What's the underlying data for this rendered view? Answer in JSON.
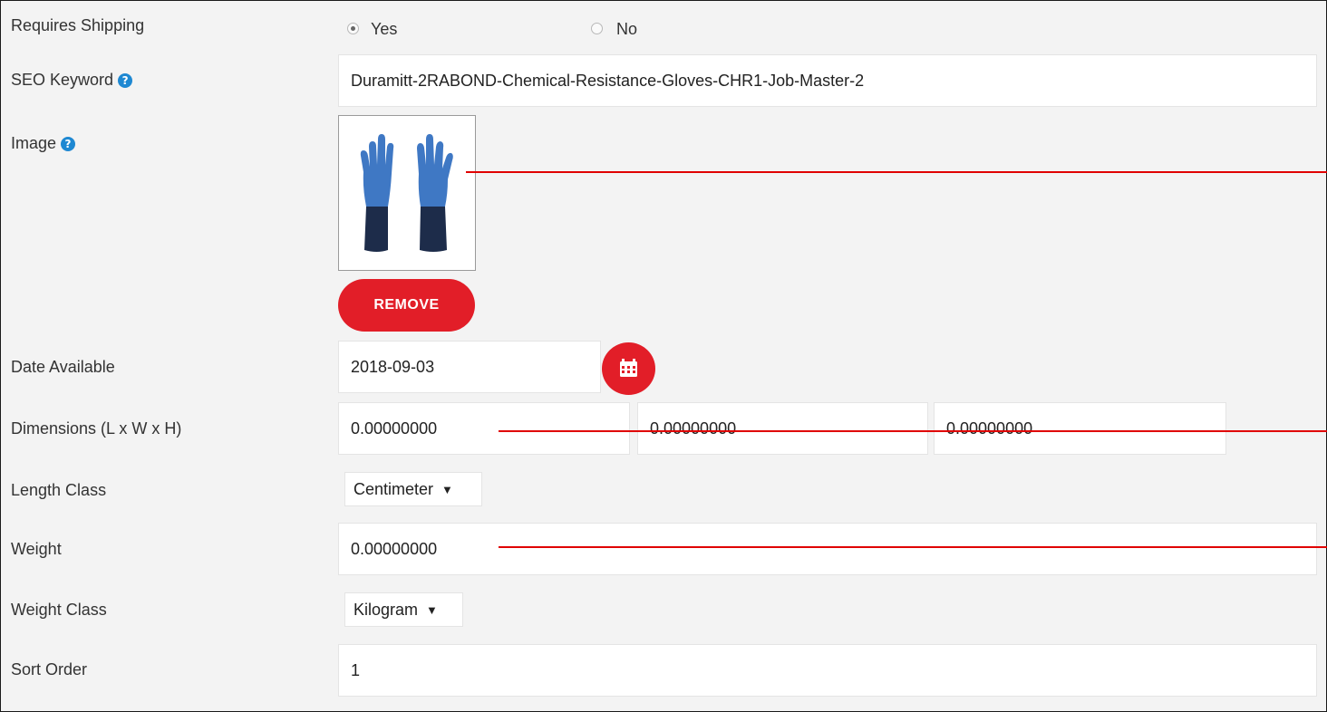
{
  "colors": {
    "accent": "#e21e28",
    "help": "#1e88d2",
    "annotation_line": "#e00000"
  },
  "shipping": {
    "label": "Requires Shipping",
    "yes_label": "Yes",
    "no_label": "No",
    "selected": "Yes"
  },
  "seo": {
    "label": "SEO Keyword",
    "value": "Duramitt-2RABOND-Chemical-Resistance-Gloves-CHR1-Job-Master-2",
    "help_icon": "question-circle-icon"
  },
  "image": {
    "label": "Image",
    "help_icon": "question-circle-icon",
    "remove_label": "REMOVE"
  },
  "date": {
    "label": "Date Available",
    "value": "2018-09-03",
    "icon": "calendar-icon"
  },
  "dimensions": {
    "label": "Dimensions (L x W x H)",
    "length": "0.00000000",
    "width": "0.00000000",
    "height": "0.00000000"
  },
  "length_class": {
    "label": "Length Class",
    "selected": "Centimeter"
  },
  "weight": {
    "label": "Weight",
    "value": "0.00000000"
  },
  "weight_class": {
    "label": "Weight Class",
    "selected": "Kilogram"
  },
  "sort_order": {
    "label": "Sort Order",
    "value": "1"
  }
}
